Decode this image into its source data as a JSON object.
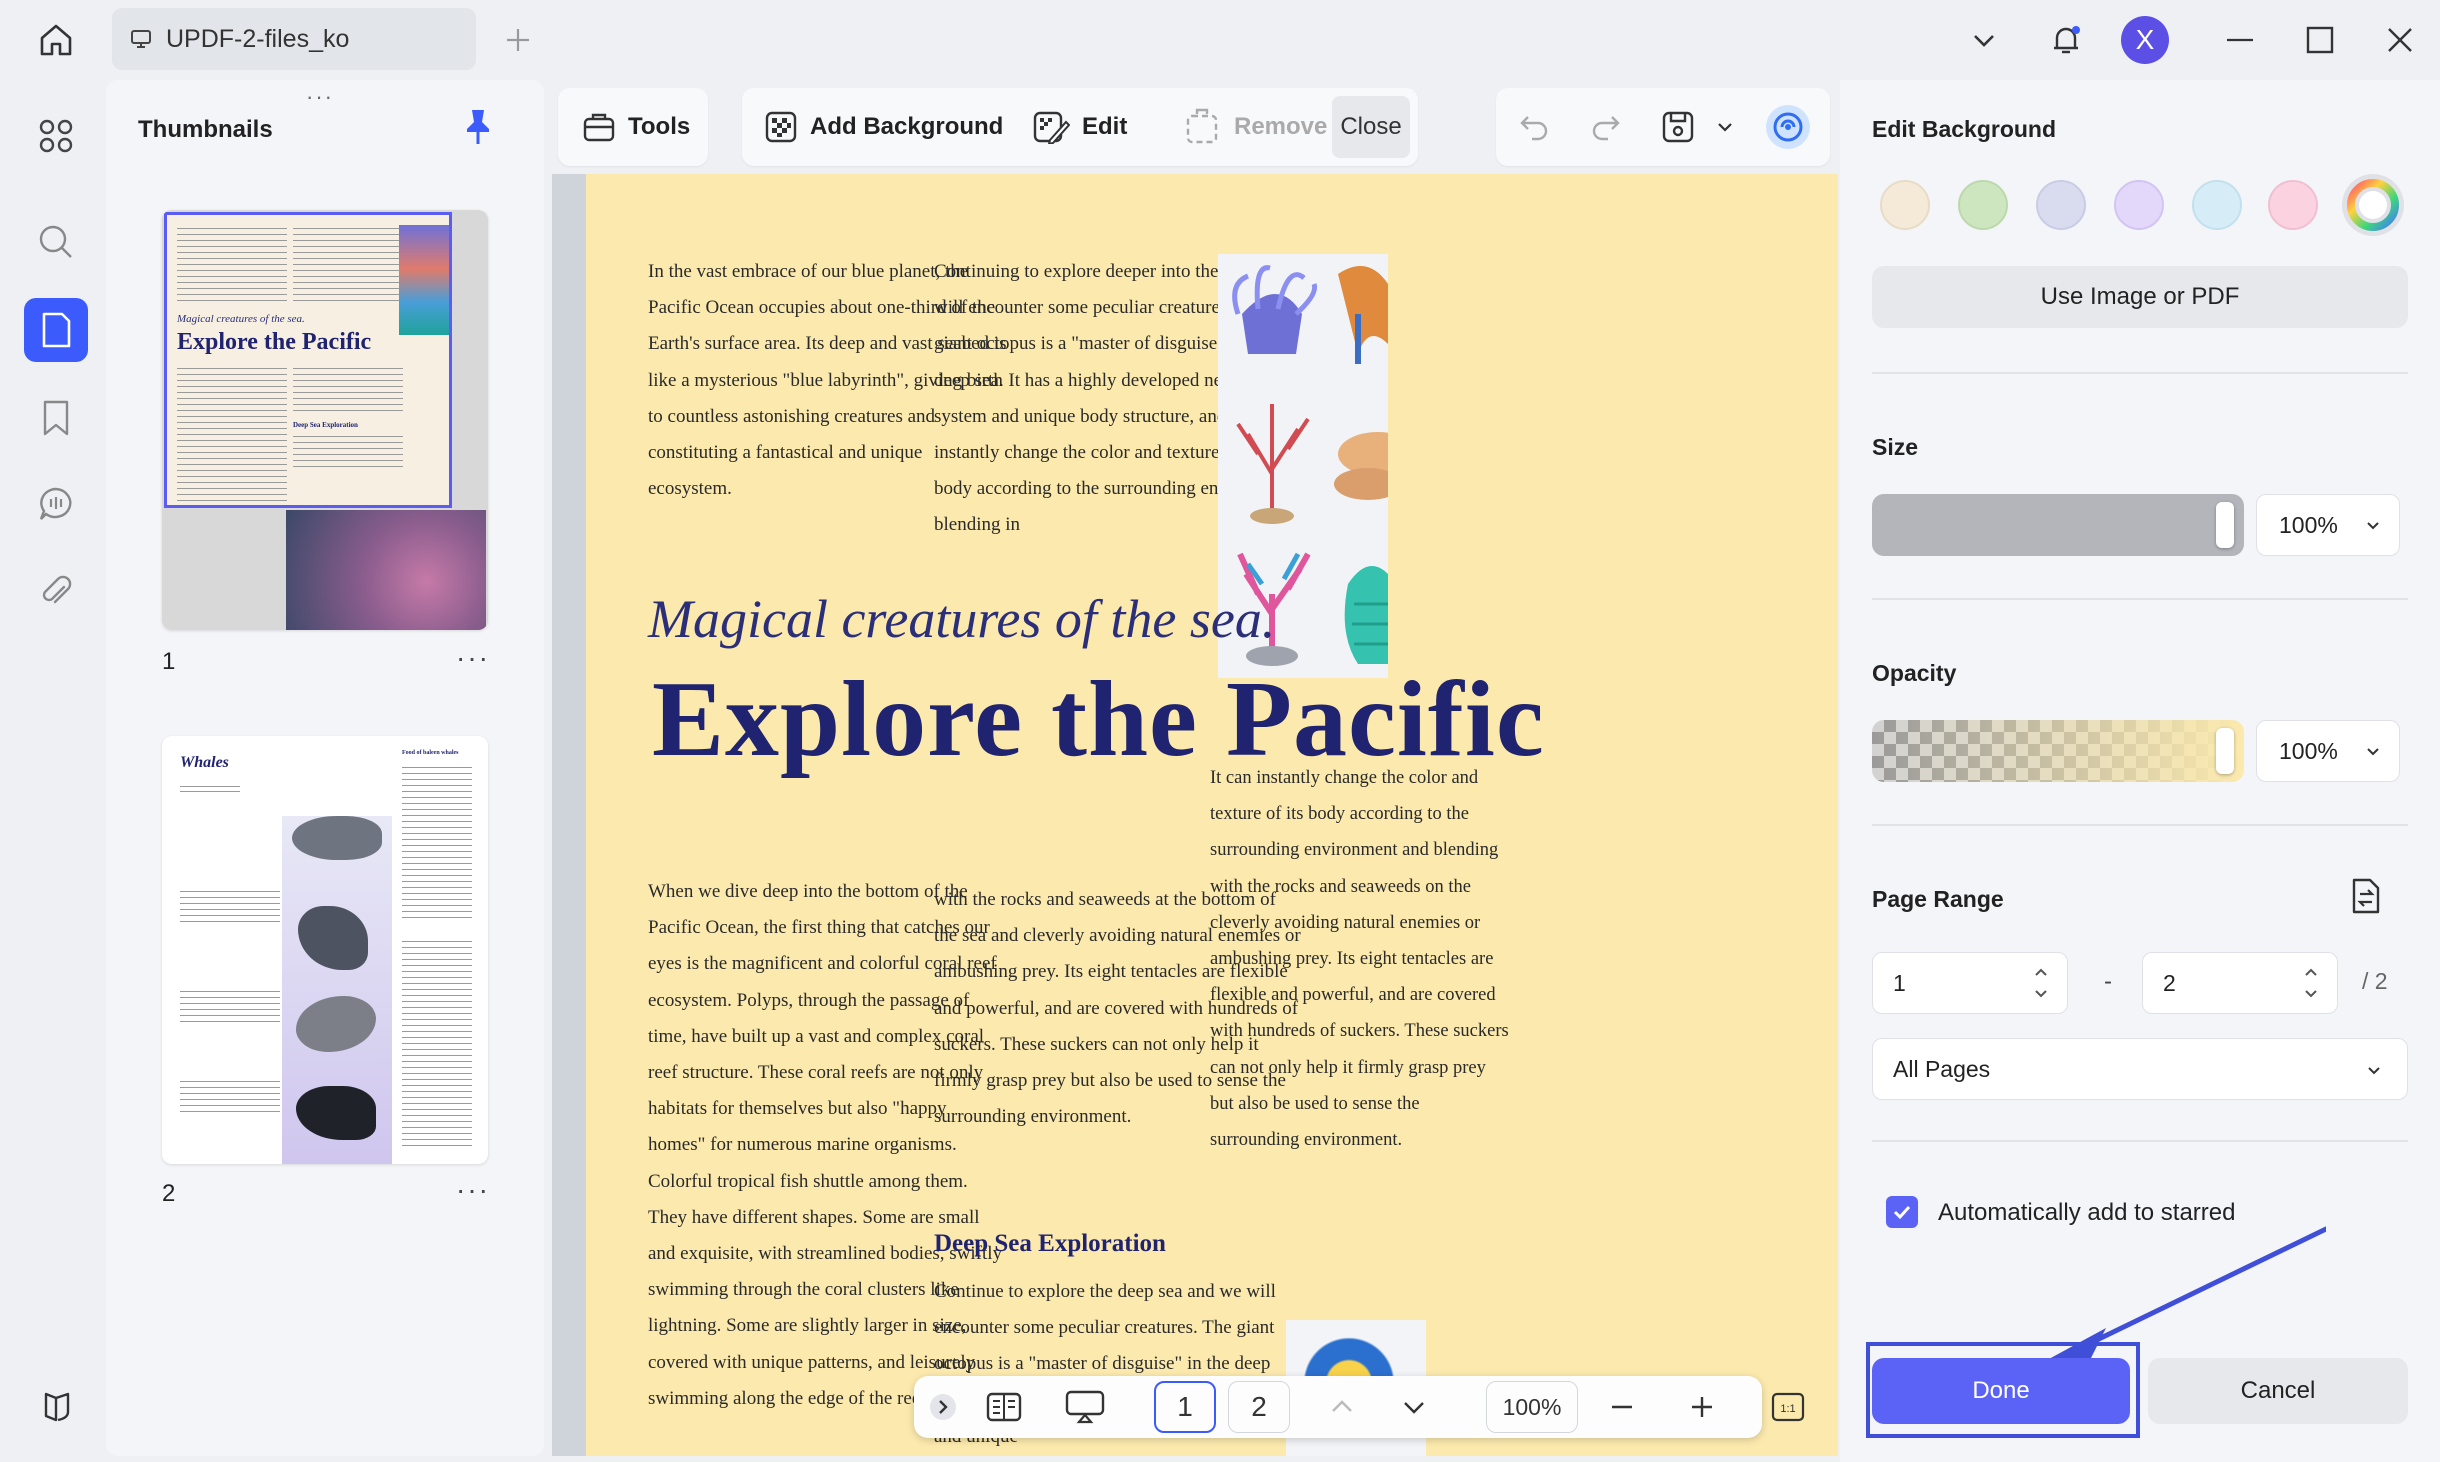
{
  "window": {
    "tab_title": "UPDF-2-files_ko",
    "avatar_initial": "X"
  },
  "thumbnails": {
    "title": "Thumbnails",
    "pages": [
      {
        "number": "1",
        "more": "···"
      },
      {
        "number": "2",
        "more": "···"
      }
    ],
    "thumb1": {
      "subtitle": "Magical creatures of the sea.",
      "title": "Explore the Pacific",
      "section": "Deep Sea Exploration"
    },
    "thumb2": {
      "title": "Whales",
      "side": "Food of baleen whales"
    }
  },
  "toolbar": {
    "tools": "Tools",
    "add_background": "Add Background",
    "edit": "Edit",
    "remove": "Remove",
    "close": "Close"
  },
  "document": {
    "col1_top": "In the vast embrace of our blue planet, the Pacific Ocean occupies about one-third of the Earth's surface area. Its deep and vast seabed is like a mysterious \"blue labyrinth\", giving birth to countless astonishing creatures and constituting a fantastical and unique ecosystem.",
    "col2_top": "Continuing to explore deeper into the ocean, we will encounter some peculiar creatures. The giant octopus is a \"master of disguise\" in the deep sea. It has a highly developed nervous system and unique body structure, and can instantly change the color and texture of its body according to the surrounding environment, blending in",
    "subtitle": "Magical creatures of the sea.",
    "headline": "Explore the Pacific",
    "col3_right": "It can instantly change the color and texture of its body according to the surrounding environment and blending with the rocks and seaweeds on the cleverly avoiding natural enemies or ambushing prey. Its eight tentacles are flexible and powerful, and are covered with hundreds of suckers. These suckers can not only help it firmly grasp prey but also be used to sense the surrounding environment.",
    "col1_bottom": "When we dive deep into the bottom of the Pacific Ocean, the first thing that catches our eyes is the magnificent and colorful coral reef ecosystem. Polyps, through the passage of time, have built up a vast and complex coral reef structure. These coral reefs are not only habitats for themselves but also \"happy homes\" for numerous marine organisms. Colorful tropical fish shuttle among them. They have different shapes. Some are small and exquisite, with streamlined bodies, swiftly swimming through the coral clusters like lightning. Some are slightly larger in size, covered with unique patterns, and leisurely swimming along the edge of the reef. The",
    "col2_bottom": "with the rocks and seaweeds at the bottom of the sea and cleverly avoiding natural enemies or ambushing prey. Its eight tentacles are flexible and powerful, and are covered with hundreds of suckers. These suckers can not only help it firmly grasp prey but also be used to sense the surrounding environment.",
    "section_title": "Deep Sea Exploration",
    "col2_section": "Continue to explore the deep sea and we will encounter some peculiar creatures. The giant octopus is a \"master of disguise\" in the deep sea. It has a highly developed nervous system and unique"
  },
  "bottombar": {
    "page_current": "1",
    "page_next": "2",
    "zoom": "100%"
  },
  "panel": {
    "title": "Edit Background",
    "swatches": [
      "#f5ead7",
      "#cde6bf",
      "#d9dcef",
      "#e3d8fa",
      "#d6edf7",
      "#fbd3e0"
    ],
    "use_image": "Use Image or PDF",
    "size_label": "Size",
    "size_value": "100%",
    "opacity_label": "Opacity",
    "opacity_value": "100%",
    "page_range_label": "Page Range",
    "range_from": "1",
    "range_sep": "-",
    "range_to": "2",
    "range_total": "/ 2",
    "pages_select": "All Pages",
    "auto_star": "Automatically add to starred",
    "done": "Done",
    "cancel": "Cancel"
  },
  "colors": {
    "accent": "#5b63f6",
    "page_bg": "#fbe9ad",
    "title_blue": "#1f2370"
  }
}
